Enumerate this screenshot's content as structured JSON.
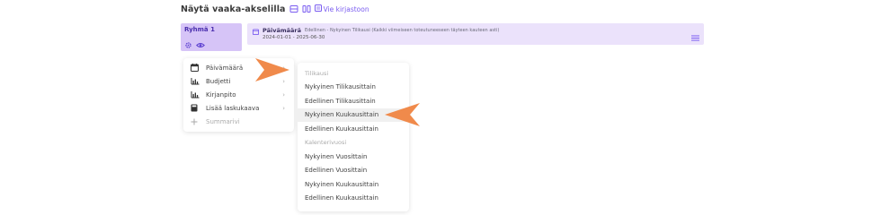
{
  "toolbar": {
    "title": "Näytä vaaka-akselilla",
    "export_label": "Vie kirjastoon"
  },
  "group": {
    "title": "Ryhmä 1"
  },
  "filter": {
    "label": "Päivämäärä",
    "description": "Edellinen - Nykyinen Tilikausi (Kaikki viimeiseen toteutuneeseen täyteen kauteen asti)",
    "range": "2024-01-01 - 2025-06-30"
  },
  "dimension_menu": {
    "items": [
      {
        "label": "Päivämäärä",
        "icon": "calendar-icon"
      },
      {
        "label": "Budjetti",
        "icon": "chart-icon"
      },
      {
        "label": "Kirjanpito",
        "icon": "chart-icon"
      },
      {
        "label": "Lisää laskukaava",
        "icon": "calculator-icon"
      },
      {
        "label": "Summarivi",
        "icon": "plus-icon"
      }
    ]
  },
  "period_menu": {
    "sections": [
      {
        "header": "Tilikausi",
        "options": [
          "Nykyinen Tilikausittain",
          "Edellinen Tilikausittain",
          "Nykyinen Kuukausittain",
          "Edellinen Kuukausittain"
        ]
      },
      {
        "header": "Kalenterivuosi",
        "options": [
          "Nykyinen Vuosittain",
          "Edellinen Vuosittain",
          "Nykyinen Kuukausittain",
          "Edellinen Kuukausittain"
        ]
      }
    ]
  },
  "colors": {
    "accent": "#7a5cf0",
    "group_bg": "#d6c4f7",
    "filter_bg": "#ebe2fb",
    "pointer": "#f08a4b"
  }
}
